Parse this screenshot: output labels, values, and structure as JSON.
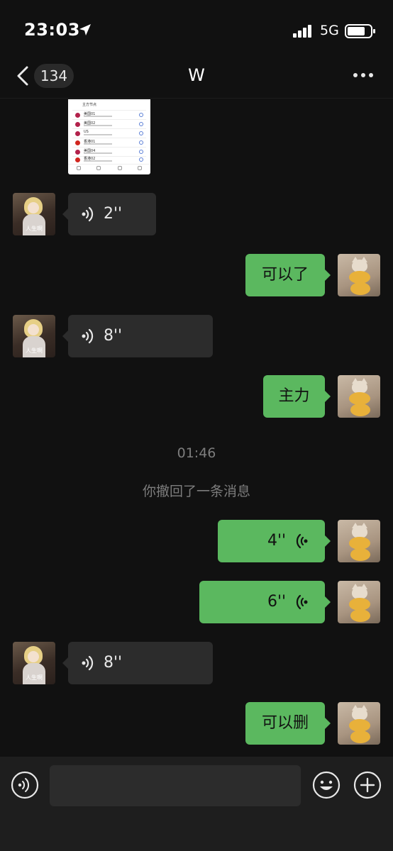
{
  "status_bar": {
    "time": "23:03",
    "network": "5G"
  },
  "nav": {
    "back_count": "134",
    "title": "W"
  },
  "screenshot_thumb": {
    "header": "主方节点",
    "rows": [
      {
        "name": "美国01",
        "flag_color": "#b2224b"
      },
      {
        "name": "美国02",
        "flag_color": "#b2224b"
      },
      {
        "name": "US",
        "flag_color": "#b2224b"
      },
      {
        "name": "香港01",
        "flag_color": "#d1261f"
      },
      {
        "name": "美国04",
        "flag_color": "#b2224b"
      },
      {
        "name": "香港02",
        "flag_color": "#d1261f"
      }
    ]
  },
  "messages": {
    "m1": {
      "from": "contact",
      "type": "voice",
      "duration": "2''"
    },
    "m2": {
      "from": "me",
      "type": "text",
      "text": "可以了"
    },
    "m3": {
      "from": "contact",
      "type": "voice",
      "duration": "8''"
    },
    "m4": {
      "from": "me",
      "type": "text",
      "text": "主力"
    },
    "m5": {
      "from": "me",
      "type": "voice",
      "duration": "4''"
    },
    "m6": {
      "from": "me",
      "type": "voice",
      "duration": "6''"
    },
    "m7": {
      "from": "contact",
      "type": "voice",
      "duration": "8''"
    },
    "m8": {
      "from": "me",
      "type": "text",
      "text": "可以删"
    }
  },
  "system": {
    "time": "01:46",
    "recall_note": "你撤回了一条消息"
  },
  "contact_avatar_caption": "人生啊",
  "input": {
    "placeholder": ""
  },
  "colors": {
    "background": "#111111",
    "outgoing_bubble": "#5bb85f",
    "incoming_bubble": "#2c2c2c",
    "input_bar": "#1e1e1e"
  },
  "icons": [
    "location-arrow-icon",
    "signal-icon",
    "battery-icon",
    "back-chevron-icon",
    "more-icon",
    "voice-wave-icon",
    "emoji-icon",
    "plus-icon"
  ]
}
